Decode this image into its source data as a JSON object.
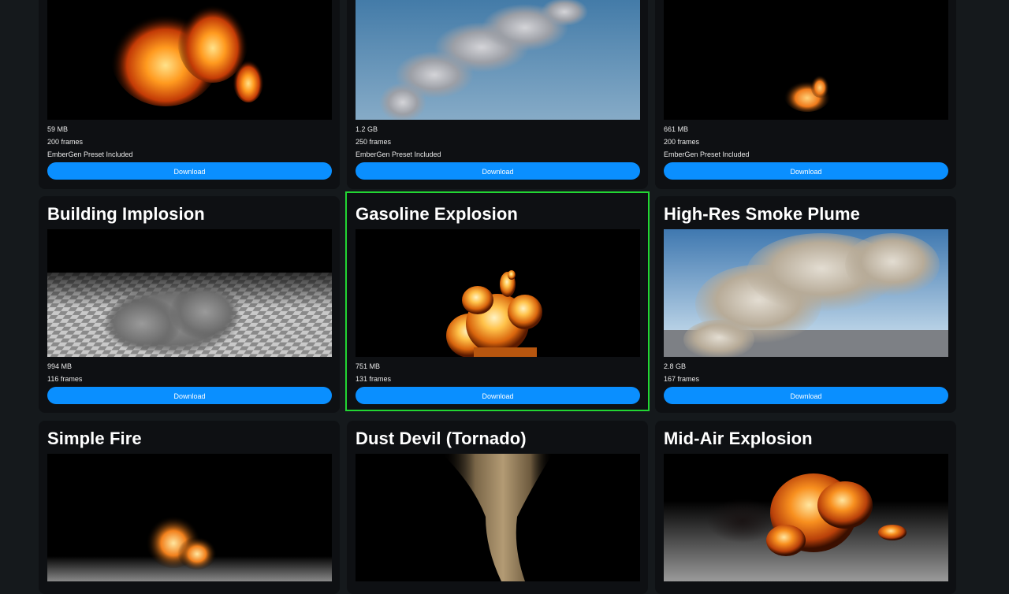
{
  "cards": [
    {
      "title": "",
      "size": "59 MB",
      "frames": "200 frames",
      "preset": "EmberGen Preset Included",
      "download": "Download",
      "thumbnail": "fire-thumbnail"
    },
    {
      "title": "",
      "size": "1.2 GB",
      "frames": "250 frames",
      "preset": "EmberGen Preset Included",
      "download": "Download",
      "thumbnail": "smoke-sky-thumbnail"
    },
    {
      "title": "",
      "size": "661 MB",
      "frames": "200 frames",
      "preset": "EmberGen Preset Included",
      "download": "Download",
      "thumbnail": "small-flame-thumbnail"
    },
    {
      "title": "Building Implosion",
      "size": "994 MB",
      "frames": "116 frames",
      "download": "Download",
      "thumbnail": "implosion-thumbnail"
    },
    {
      "title": "Gasoline Explosion",
      "size": "751 MB",
      "frames": "131 frames",
      "download": "Download",
      "thumbnail": "explosion-thumbnail",
      "selected": true
    },
    {
      "title": "High-Res Smoke Plume",
      "size": "2.8 GB",
      "frames": "167 frames",
      "download": "Download",
      "thumbnail": "smoke-plume-thumbnail"
    },
    {
      "title": "Simple Fire",
      "thumbnail": "simple-fire-thumbnail"
    },
    {
      "title": "Dust Devil (Tornado)",
      "thumbnail": "dust-devil-thumbnail"
    },
    {
      "title": "Mid-Air Explosion",
      "thumbnail": "mid-air-explosion-thumbnail"
    }
  ],
  "colors": {
    "background": "#15191c",
    "card": "#0e1013",
    "accent": "#0a8fff",
    "selection": "#22d633"
  }
}
